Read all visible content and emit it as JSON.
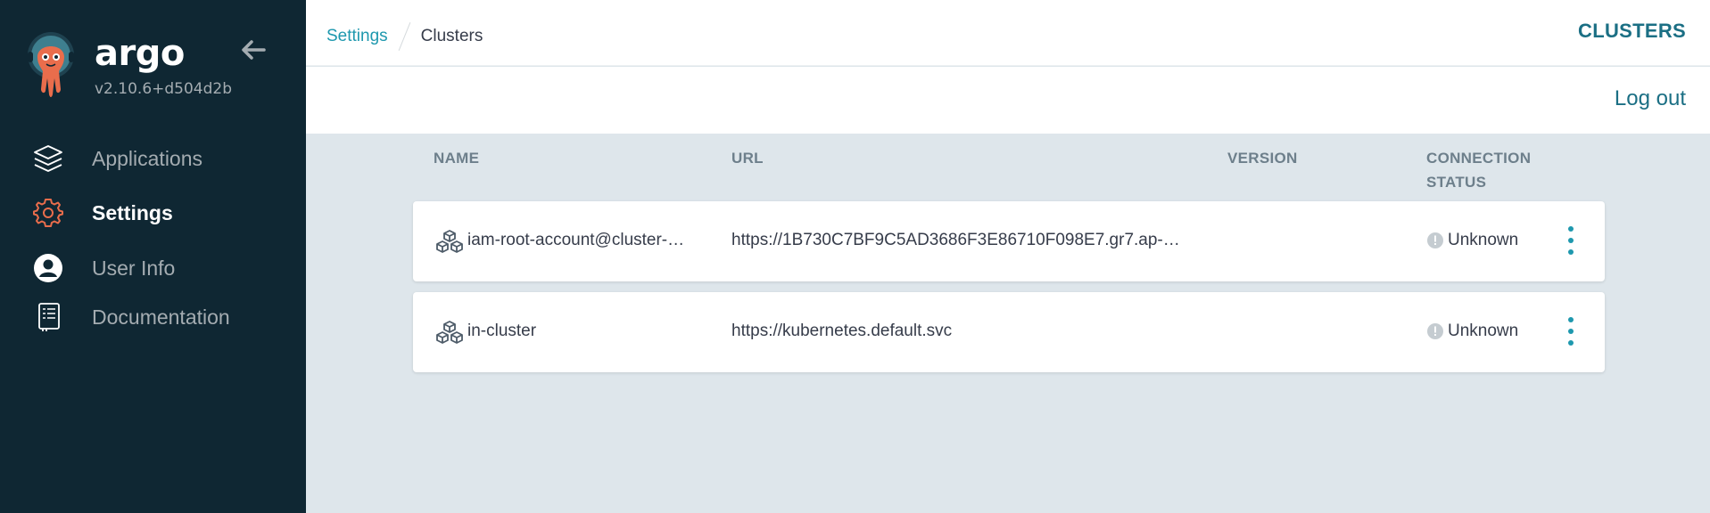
{
  "app": {
    "brand": "argo",
    "version": "v2.10.6+d504d2b"
  },
  "sidebar": {
    "items": [
      {
        "label": "Applications",
        "icon": "layers-icon",
        "active": false
      },
      {
        "label": "Settings",
        "icon": "gear-icon",
        "active": true
      },
      {
        "label": "User Info",
        "icon": "user-circle-icon",
        "active": false
      },
      {
        "label": "Documentation",
        "icon": "book-icon",
        "active": false
      }
    ]
  },
  "header": {
    "breadcrumb_parent": "Settings",
    "breadcrumb_current": "Clusters",
    "title": "CLUSTERS",
    "logout": "Log out"
  },
  "table": {
    "columns": [
      "NAME",
      "URL",
      "VERSION",
      "CONNECTION",
      "STATUS"
    ],
    "rows": [
      {
        "name": "iam-root-account@cluster-…",
        "url": "https://1B730C7BF9C5AD3686F3E86710F098E7.gr7.ap-…",
        "version": "",
        "status": "Unknown"
      },
      {
        "name": "in-cluster",
        "url": "https://kubernetes.default.svc",
        "version": "",
        "status": "Unknown"
      }
    ]
  },
  "colors": {
    "sidebar_bg": "#0f2733",
    "accent": "#1e98ae",
    "title": "#1b6f84",
    "content_bg": "#dee6eb",
    "settings_icon": "#e96d4c"
  }
}
